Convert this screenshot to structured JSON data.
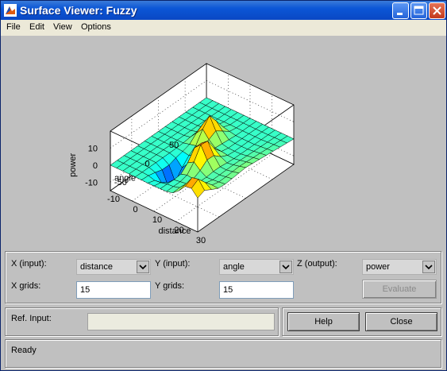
{
  "window": {
    "title": "Surface Viewer: Fuzzy",
    "icon": "matlab-icon",
    "controls": [
      "minimize-icon",
      "maximize-icon",
      "close-icon"
    ]
  },
  "menu": [
    "File",
    "Edit",
    "View",
    "Options"
  ],
  "chart_data": {
    "type": "surface",
    "x_axis_label": "distance",
    "y_axis_label": "angle",
    "z_axis_label": "power",
    "x_ticks": [
      "-10",
      "0",
      "10",
      "20",
      "30"
    ],
    "y_ticks": [
      "50",
      "0",
      "-50"
    ],
    "z_ticks": [
      "10",
      "0",
      "-10"
    ],
    "xlim": [
      -10,
      30
    ],
    "ylim": [
      -90,
      90
    ],
    "zlim": [
      -15,
      20
    ],
    "grid": true,
    "colormap": "jet"
  },
  "inputs": {
    "x_input_label": "X (input):",
    "x_input_value": "distance",
    "y_input_label": "Y (input):",
    "y_input_value": "angle",
    "z_output_label": "Z (output):",
    "z_output_value": "power",
    "x_grids_label": "X grids:",
    "x_grids_value": "15",
    "y_grids_label": "Y grids:",
    "y_grids_value": "15",
    "evaluate_label": "Evaluate"
  },
  "ref": {
    "label": "Ref. Input:",
    "value": "",
    "help_label": "Help",
    "close_label": "Close"
  },
  "status": "Ready"
}
